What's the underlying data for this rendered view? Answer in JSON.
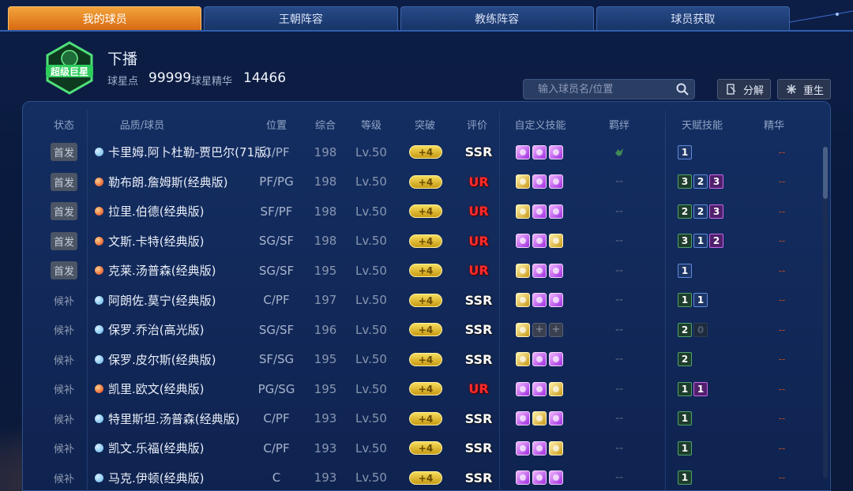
{
  "tabs": [
    {
      "label": "我的球员",
      "active": true
    },
    {
      "label": "王朝阵容",
      "active": false
    },
    {
      "label": "教练阵容",
      "active": false
    },
    {
      "label": "球员获取",
      "active": false
    }
  ],
  "header": {
    "logo_text": "超级巨星",
    "player_name": "下播",
    "points_label": "球星点",
    "points_value": "99999",
    "essence_label": "球星精华",
    "essence_value": "14466"
  },
  "toolbar": {
    "search_placeholder": "输入球员名/位置",
    "decompose_label": "分解",
    "rebirth_label": "重生"
  },
  "columns": {
    "status": "状态",
    "player": "品质/球员",
    "position": "位置",
    "overall": "综合",
    "level": "等级",
    "breakthrough": "突破",
    "grade": "评价",
    "custom_skills": "自定义技能",
    "bond": "羁绊",
    "talent_skills": "天赋技能",
    "essence": "精华"
  },
  "players": [
    {
      "status": "首发",
      "starter": true,
      "quality": "blue",
      "name": "卡里姆.阿卜杜勒-贾巴尔(71版)",
      "position": "C/PF",
      "overall": "198",
      "level": "Lv.50",
      "breakthrough": "+4",
      "grade": "SSR",
      "skills": [
        "purple",
        "purple",
        "purple"
      ],
      "bond": "icon",
      "talents": [
        {
          "v": "1",
          "c": "blue"
        }
      ],
      "essence": "--"
    },
    {
      "status": "首发",
      "starter": true,
      "quality": "red",
      "name": "勒布朗.詹姆斯(经典版)",
      "position": "PF/PG",
      "overall": "198",
      "level": "Lv.50",
      "breakthrough": "+4",
      "grade": "UR",
      "skills": [
        "gold",
        "purple",
        "purple"
      ],
      "bond": "--",
      "talents": [
        {
          "v": "3",
          "c": "green"
        },
        {
          "v": "2",
          "c": "blue"
        },
        {
          "v": "3",
          "c": "purple"
        }
      ],
      "essence": "--"
    },
    {
      "status": "首发",
      "starter": true,
      "quality": "red",
      "name": "拉里.伯德(经典版)",
      "position": "SF/PF",
      "overall": "198",
      "level": "Lv.50",
      "breakthrough": "+4",
      "grade": "UR",
      "skills": [
        "gold",
        "purple",
        "purple"
      ],
      "bond": "--",
      "talents": [
        {
          "v": "2",
          "c": "green"
        },
        {
          "v": "2",
          "c": "blue"
        },
        {
          "v": "3",
          "c": "purple"
        }
      ],
      "essence": "--"
    },
    {
      "status": "首发",
      "starter": true,
      "quality": "red",
      "name": "文斯.卡特(经典版)",
      "position": "SG/SF",
      "overall": "198",
      "level": "Lv.50",
      "breakthrough": "+4",
      "grade": "UR",
      "skills": [
        "purple",
        "purple",
        "gold"
      ],
      "bond": "--",
      "talents": [
        {
          "v": "3",
          "c": "green"
        },
        {
          "v": "1",
          "c": "blue"
        },
        {
          "v": "2",
          "c": "purple"
        }
      ],
      "essence": "--"
    },
    {
      "status": "首发",
      "starter": true,
      "quality": "red",
      "name": "克莱.汤普森(经典版)",
      "position": "SG/SF",
      "overall": "195",
      "level": "Lv.50",
      "breakthrough": "+4",
      "grade": "UR",
      "skills": [
        "gold",
        "purple",
        "purple"
      ],
      "bond": "--",
      "talents": [
        {
          "v": "1",
          "c": "blue"
        }
      ],
      "essence": "--"
    },
    {
      "status": "候补",
      "starter": false,
      "quality": "blue",
      "name": "阿朗佐.莫宁(经典版)",
      "position": "C/PF",
      "overall": "197",
      "level": "Lv.50",
      "breakthrough": "+4",
      "grade": "SSR",
      "skills": [
        "gold",
        "purple",
        "purple"
      ],
      "bond": "--",
      "talents": [
        {
          "v": "1",
          "c": "green"
        },
        {
          "v": "1",
          "c": "blue"
        }
      ],
      "essence": "--"
    },
    {
      "status": "候补",
      "starter": false,
      "quality": "blue",
      "name": "保罗.乔治(高光版)",
      "position": "SG/SF",
      "overall": "196",
      "level": "Lv.50",
      "breakthrough": "+4",
      "grade": "SSR",
      "skills": [
        "gold",
        "empty",
        "empty"
      ],
      "bond": "--",
      "talents": [
        {
          "v": "2",
          "c": "green"
        },
        {
          "v": "0",
          "c": "dim"
        }
      ],
      "essence": "--"
    },
    {
      "status": "候补",
      "starter": false,
      "quality": "blue",
      "name": "保罗.皮尔斯(经典版)",
      "position": "SF/SG",
      "overall": "195",
      "level": "Lv.50",
      "breakthrough": "+4",
      "grade": "SSR",
      "skills": [
        "gold",
        "purple",
        "purple"
      ],
      "bond": "--",
      "talents": [
        {
          "v": "2",
          "c": "green"
        }
      ],
      "essence": "--"
    },
    {
      "status": "候补",
      "starter": false,
      "quality": "red",
      "name": "凯里.欧文(经典版)",
      "position": "PG/SG",
      "overall": "195",
      "level": "Lv.50",
      "breakthrough": "+4",
      "grade": "UR",
      "skills": [
        "purple",
        "purple",
        "gold"
      ],
      "bond": "--",
      "talents": [
        {
          "v": "1",
          "c": "green"
        },
        {
          "v": "1",
          "c": "purple"
        }
      ],
      "essence": "--"
    },
    {
      "status": "候补",
      "starter": false,
      "quality": "blue",
      "name": "特里斯坦.汤普森(经典版)",
      "position": "C/PF",
      "overall": "193",
      "level": "Lv.50",
      "breakthrough": "+4",
      "grade": "SSR",
      "skills": [
        "purple",
        "gold",
        "purple"
      ],
      "bond": "--",
      "talents": [
        {
          "v": "1",
          "c": "green"
        }
      ],
      "essence": "--"
    },
    {
      "status": "候补",
      "starter": false,
      "quality": "blue",
      "name": "凯文.乐福(经典版)",
      "position": "C/PF",
      "overall": "193",
      "level": "Lv.50",
      "breakthrough": "+4",
      "grade": "SSR",
      "skills": [
        "purple",
        "purple",
        "gold"
      ],
      "bond": "--",
      "talents": [
        {
          "v": "1",
          "c": "green"
        }
      ],
      "essence": "--"
    },
    {
      "status": "候补",
      "starter": false,
      "quality": "blue",
      "name": "马克.伊顿(经典版)",
      "position": "C",
      "overall": "193",
      "level": "Lv.50",
      "breakthrough": "+4",
      "grade": "SSR",
      "skills": [
        "purple",
        "purple",
        "purple"
      ],
      "bond": "--",
      "talents": [
        {
          "v": "1",
          "c": "green"
        }
      ],
      "essence": "--"
    }
  ]
}
